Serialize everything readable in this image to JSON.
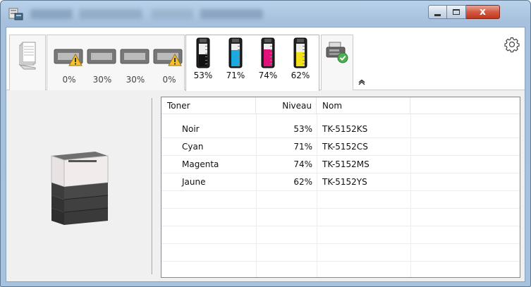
{
  "window": {
    "title": "",
    "buttons": {
      "minimize": "",
      "maximize": "",
      "close": "x"
    }
  },
  "toolbar": {
    "trays": [
      {
        "percent": "0%",
        "warning": true
      },
      {
        "percent": "30%",
        "warning": false
      },
      {
        "percent": "30%",
        "warning": false
      },
      {
        "percent": "0%",
        "warning": true
      }
    ],
    "toners": [
      {
        "percent": "53%",
        "level": 0.53,
        "color": "#111111"
      },
      {
        "percent": "71%",
        "level": 0.71,
        "color": "#1aa9e0"
      },
      {
        "percent": "74%",
        "level": 0.74,
        "color": "#e0137a"
      },
      {
        "percent": "62%",
        "level": 0.62,
        "color": "#f2e01b"
      }
    ],
    "icons": [
      "paper-stack-icon",
      "tray-icon",
      "warning-icon",
      "toner-icon",
      "printer-status-icon",
      "collapse-chevron-icon",
      "gear-icon"
    ]
  },
  "table": {
    "headers": {
      "toner": "Toner",
      "niveau": "Niveau",
      "nom": "Nom"
    },
    "rows": [
      {
        "toner": "Noir",
        "niveau": "53%",
        "nom": "TK-5152KS"
      },
      {
        "toner": "Cyan",
        "niveau": "71%",
        "nom": "TK-5152CS"
      },
      {
        "toner": "Magenta",
        "niveau": "74%",
        "nom": "TK-5152MS"
      },
      {
        "toner": "Jaune",
        "niveau": "62%",
        "nom": "TK-5152YS"
      }
    ]
  }
}
